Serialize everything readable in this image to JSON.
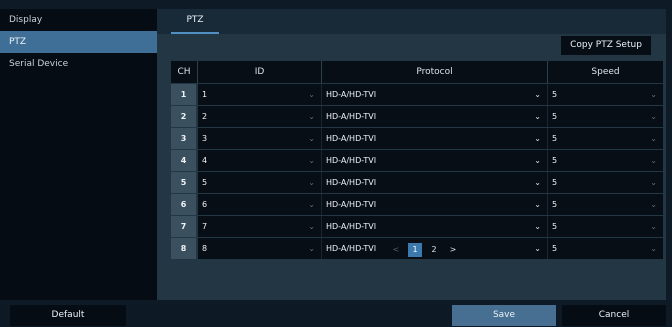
{
  "sidebar": {
    "items": [
      {
        "label": "Display"
      },
      {
        "label": "PTZ"
      },
      {
        "label": "Serial Device"
      }
    ]
  },
  "tabs": [
    {
      "label": "PTZ"
    }
  ],
  "copy_button": "Copy PTZ Setup",
  "table": {
    "headers": {
      "ch": "CH",
      "id": "ID",
      "protocol": "Protocol",
      "speed": "Speed"
    },
    "rows": [
      {
        "ch": "1",
        "id": "1",
        "protocol": "HD-A/HD-TVI",
        "speed": "5"
      },
      {
        "ch": "2",
        "id": "2",
        "protocol": "HD-A/HD-TVI",
        "speed": "5"
      },
      {
        "ch": "3",
        "id": "3",
        "protocol": "HD-A/HD-TVI",
        "speed": "5"
      },
      {
        "ch": "4",
        "id": "4",
        "protocol": "HD-A/HD-TVI",
        "speed": "5"
      },
      {
        "ch": "5",
        "id": "5",
        "protocol": "HD-A/HD-TVI",
        "speed": "5"
      },
      {
        "ch": "6",
        "id": "6",
        "protocol": "HD-A/HD-TVI",
        "speed": "5"
      },
      {
        "ch": "7",
        "id": "7",
        "protocol": "HD-A/HD-TVI",
        "speed": "5"
      },
      {
        "ch": "8",
        "id": "8",
        "protocol": "HD-A/HD-TVI",
        "speed": "5"
      }
    ]
  },
  "pagination": {
    "pages": [
      "1",
      "2"
    ],
    "current": "1"
  },
  "footer": {
    "default": "Default",
    "save": "Save",
    "cancel": "Cancel"
  },
  "icons": {
    "prev": "chevron-left-icon",
    "next": "chevron-right-icon",
    "dropdown": "chevron-down-icon"
  },
  "colors": {
    "accent": "#3c79ad",
    "active_sidebar": "#3f6f96",
    "save": "#466f91"
  }
}
